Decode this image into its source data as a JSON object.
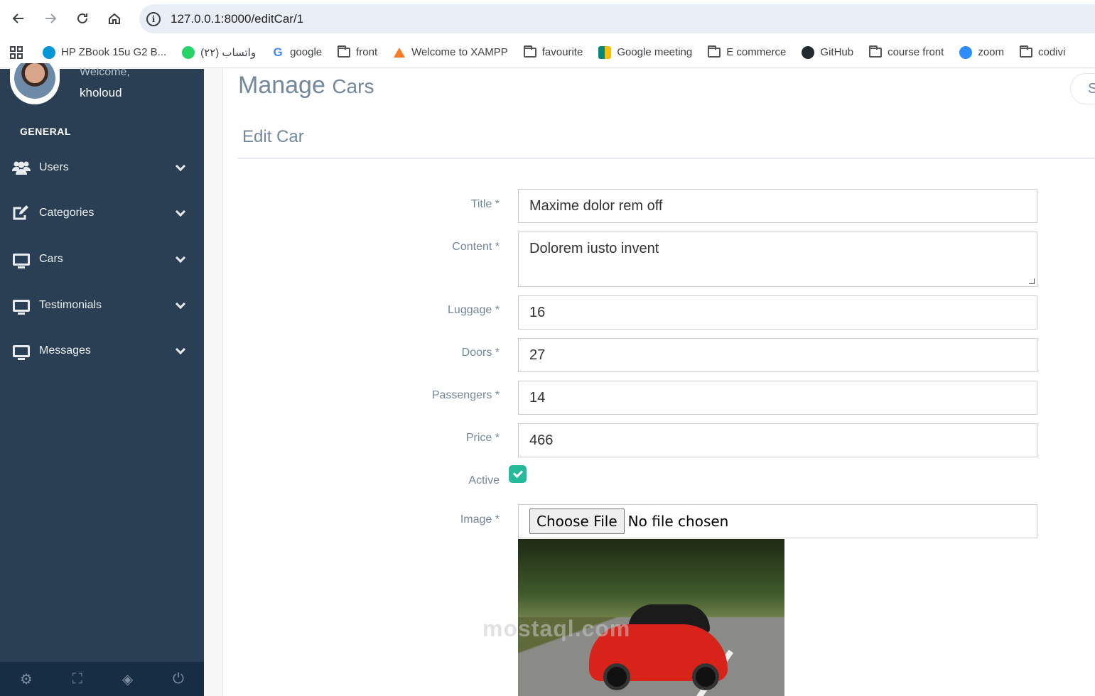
{
  "browser": {
    "url": "127.0.0.1:8000/editCar/1",
    "bookmarks": [
      {
        "label": "HP ZBook 15u G2 B...",
        "icon": "hp-icon",
        "color": "#0096d6"
      },
      {
        "label": "واتساب (٢٢)",
        "icon": "whatsapp-icon",
        "color": "#25d366"
      },
      {
        "label": "google",
        "icon": "google-icon",
        "color": "#4285f4"
      },
      {
        "label": "front",
        "icon": "folder-icon"
      },
      {
        "label": "Welcome to XAMPP",
        "icon": "xampp-icon",
        "color": "#fb7a24"
      },
      {
        "label": "favourite",
        "icon": "folder-icon"
      },
      {
        "label": "Google meeting",
        "icon": "meet-icon",
        "color": "#00897b"
      },
      {
        "label": "E commerce",
        "icon": "folder-icon"
      },
      {
        "label": "GitHub",
        "icon": "github-icon",
        "color": "#24292f"
      },
      {
        "label": "course front",
        "icon": "folder-icon"
      },
      {
        "label": "zoom",
        "icon": "zoom-icon",
        "color": "#2d8cff"
      },
      {
        "label": "codivi",
        "icon": "folder-icon"
      }
    ]
  },
  "sidebar": {
    "welcome": "Welcome,",
    "username": "kholoud",
    "section": "GENERAL",
    "items": [
      {
        "label": "Users",
        "icon": "users-icon"
      },
      {
        "label": "Categories",
        "icon": "edit-icon"
      },
      {
        "label": "Cars",
        "icon": "monitor-icon"
      },
      {
        "label": "Testimonials",
        "icon": "monitor-icon"
      },
      {
        "label": "Messages",
        "icon": "monitor-icon"
      }
    ],
    "footer_icons": [
      "settings-icon",
      "fullscreen-icon",
      "eye-slash-icon",
      "power-icon"
    ]
  },
  "main": {
    "title": "Manage",
    "title_small": "Cars",
    "search_partial": "S",
    "card_title": "Edit Car",
    "fields": {
      "title": {
        "label": "Title *",
        "value": "Maxime dolor rem off"
      },
      "content": {
        "label": "Content *",
        "value": "Dolorem iusto invent"
      },
      "luggage": {
        "label": "Luggage *",
        "value": "16"
      },
      "doors": {
        "label": "Doors *",
        "value": "27"
      },
      "passengers": {
        "label": "Passengers *",
        "value": "14"
      },
      "price": {
        "label": "Price *",
        "value": "466"
      },
      "active": {
        "label": "Active",
        "checked": true
      },
      "image": {
        "label": "Image *",
        "button": "Choose File",
        "status": "No file chosen"
      }
    },
    "watermark": "mostaql.com"
  },
  "colors": {
    "sidebar": "#2a3f54",
    "accent": "#26b99a",
    "label": "#73879c"
  }
}
